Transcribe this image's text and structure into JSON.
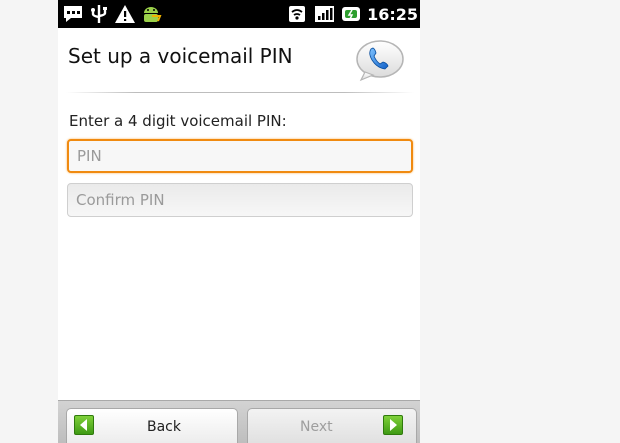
{
  "status_bar": {
    "time": "16:25",
    "left_icons": [
      "chat-notification-icon",
      "usb-icon",
      "warning-icon",
      "android-icon"
    ],
    "right_icons": [
      "wifi-icon",
      "signal-icon",
      "battery-icon"
    ]
  },
  "screen": {
    "title": "Set up a voicemail PIN",
    "title_icon": "voicemail-phone-icon",
    "prompt": "Enter a 4 digit voicemail PIN:",
    "pin_field": {
      "placeholder": "PIN",
      "value": ""
    },
    "confirm_field": {
      "placeholder": "Confirm PIN",
      "value": ""
    }
  },
  "nav": {
    "back_label": "Back",
    "next_label": "Next",
    "next_enabled": false
  },
  "colors": {
    "focus_border": "#f08a10",
    "arrow_green": "#3f9a14"
  }
}
